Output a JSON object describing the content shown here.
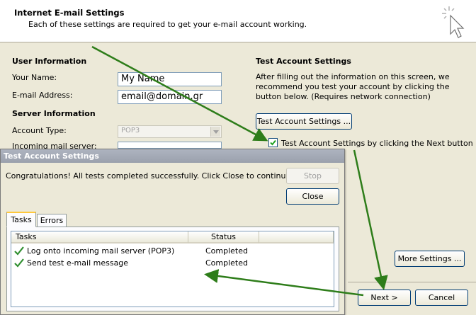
{
  "header": {
    "title": "Internet E-mail Settings",
    "subtitle": "Each of these settings are required to get your e-mail account working."
  },
  "user_info": {
    "title": "User Information",
    "name_label": "Your Name:",
    "name_value": "My Name",
    "email_label": "E-mail Address:",
    "email_value": "email@domain.gr"
  },
  "server_info": {
    "title": "Server Information",
    "account_type_label": "Account Type:",
    "account_type_value": "POP3",
    "incoming_label": "Incoming mail server:"
  },
  "test_settings": {
    "title": "Test Account Settings",
    "description": "After filling out the information on this screen, we recommend you test your account by clicking the button below. (Requires network connection)",
    "test_button": "Test Account Settings ...",
    "checkbox_label": "Test Account Settings by clicking the Next button",
    "checkbox_checked": true
  },
  "more_settings_button": "More Settings ...",
  "footer": {
    "next_button": "Next >",
    "cancel_button": "Cancel"
  },
  "dialog": {
    "title": "Test Account Settings",
    "message": "Congratulations! All tests completed successfully. Click Close to continue.",
    "stop_button": "Stop",
    "close_button": "Close",
    "tabs": [
      "Tasks",
      "Errors"
    ],
    "columns": [
      "Tasks",
      "Status"
    ],
    "rows": [
      {
        "task": "Log onto incoming mail server (POP3)",
        "status": "Completed"
      },
      {
        "task": "Send test e-mail message",
        "status": "Completed"
      }
    ]
  },
  "colors": {
    "annotation_arrow": "#2e7d1a",
    "check_mark": "#2f8f2f"
  },
  "icons": [
    "cursor-click-icon",
    "check-icon",
    "dropdown-arrow-icon"
  ]
}
